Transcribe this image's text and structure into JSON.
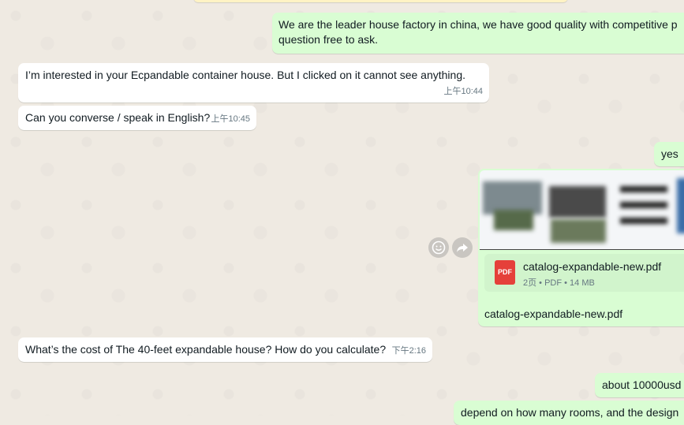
{
  "messages": {
    "m1": {
      "text": "We are the leader house factory in china, we have good quality with competitive p",
      "text2": "question free to ask."
    },
    "m2": {
      "text": "I’m interested in your Ecpandable container house. But I clicked on it cannot see anything.",
      "time": "上午10:44"
    },
    "m3": {
      "text": "Can you converse / speak in English?",
      "time": "上午10:45"
    },
    "m4": {
      "text": "yes"
    },
    "m5": {
      "file_name": "catalog-expandable-new.pdf",
      "file_meta": "2页 • PDF • 14 MB",
      "file_badge": "PDF",
      "caption": "catalog-expandable-new.pdf"
    },
    "m6": {
      "text": "What’s the cost of The 40-feet expandable house? How do you calculate?",
      "time": "下午2:16"
    },
    "m7": {
      "text": "about 10000usd"
    },
    "m8": {
      "text": "depend on how many rooms, and the design"
    }
  },
  "icons": {
    "emoji": "emoji-icon",
    "forward": "forward-icon",
    "pdf": "pdf-icon"
  }
}
